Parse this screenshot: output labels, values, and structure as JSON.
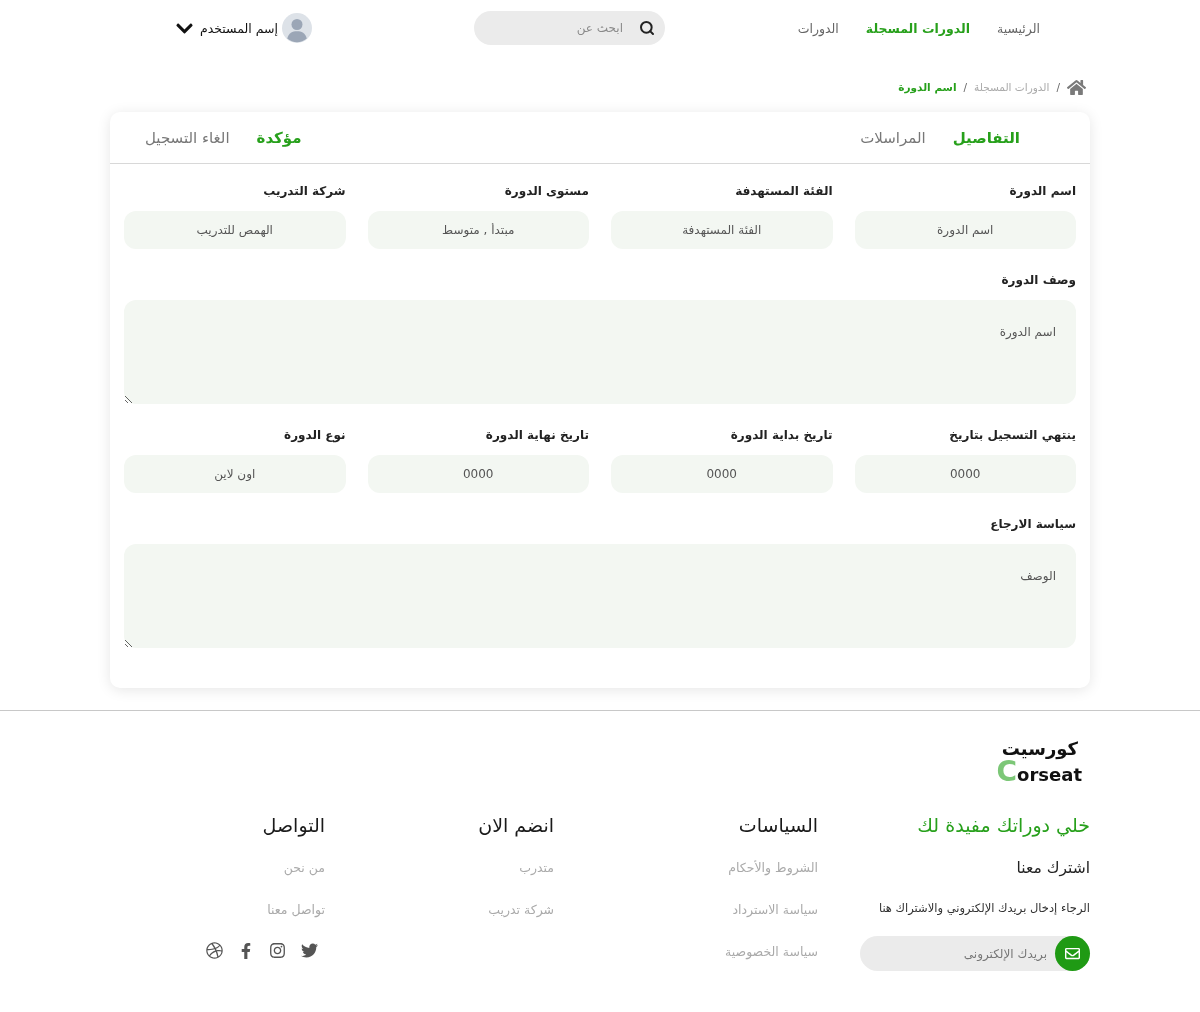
{
  "header": {
    "nav": [
      {
        "label": "الرئيسية",
        "selected": false
      },
      {
        "label": "الدورات المسجلة",
        "selected": true
      },
      {
        "label": "الدورات",
        "selected": false
      }
    ],
    "search": {
      "placeholder": "ابحث عن"
    },
    "user": {
      "name": "إسم المستخدم"
    }
  },
  "breadcrumb": {
    "items": [
      {
        "separator": "/",
        "label": "الدورات المسجلة",
        "current": false
      },
      {
        "separator": "/",
        "label": "اسم الدورة",
        "current": true
      }
    ]
  },
  "tabs": [
    {
      "label": "التفاصيل",
      "selected": true
    },
    {
      "label": "المراسلات",
      "selected": false
    }
  ],
  "enrollment": {
    "status": "مؤكدة",
    "cancel": "الغاء التسجيل"
  },
  "fields": [
    {
      "kind": "input",
      "label": "اسم الدورة",
      "value": "اسم الدورة"
    },
    {
      "kind": "input",
      "label": "الفئة المستهدفة",
      "value": "الفئة المستهدفة"
    },
    {
      "kind": "input",
      "label": "مستوى الدورة",
      "value": "مبتدأ , متوسط"
    },
    {
      "kind": "input",
      "label": "شركة التدريب",
      "value": "الهمص للتدريب"
    },
    {
      "kind": "textarea",
      "label": "وصف الدورة",
      "value": "اسم الدورة"
    },
    {
      "kind": "input",
      "label": "ينتهي التسجيل بتاريخ",
      "value": "0000"
    },
    {
      "kind": "input",
      "label": "تاريخ بداية الدورة",
      "value": "0000"
    },
    {
      "kind": "input",
      "label": "تاريخ نهاية الدورة",
      "value": "0000"
    },
    {
      "kind": "input",
      "label": "نوع الدورة",
      "value": "اون لاين"
    },
    {
      "kind": "textarea",
      "label": "سياسة الارجاع",
      "value": "الوصف"
    }
  ],
  "footer": {
    "logo": {
      "arabic": "كورسيت",
      "latin": "Corseat"
    },
    "subscribe": {
      "title": "خلي دوراتك مفيدة لك",
      "subtitle": "اشترك معنا",
      "text": "الرجاء إدخال بريدك الإلكتروني والاشتراك هنا",
      "email_placeholder": "بريدك الإلكترونى"
    },
    "columns": [
      {
        "title": "السياسات",
        "links": [
          "الشروط والأحكام",
          "سياسة الاسترداد",
          "سياسة الخصوصية"
        ]
      },
      {
        "title": "انضم الان",
        "links": [
          "متدرب",
          "شركة تدريب"
        ]
      },
      {
        "title": "التواصل",
        "links": [
          "من نحن",
          "تواصل معنا"
        ]
      }
    ]
  }
}
